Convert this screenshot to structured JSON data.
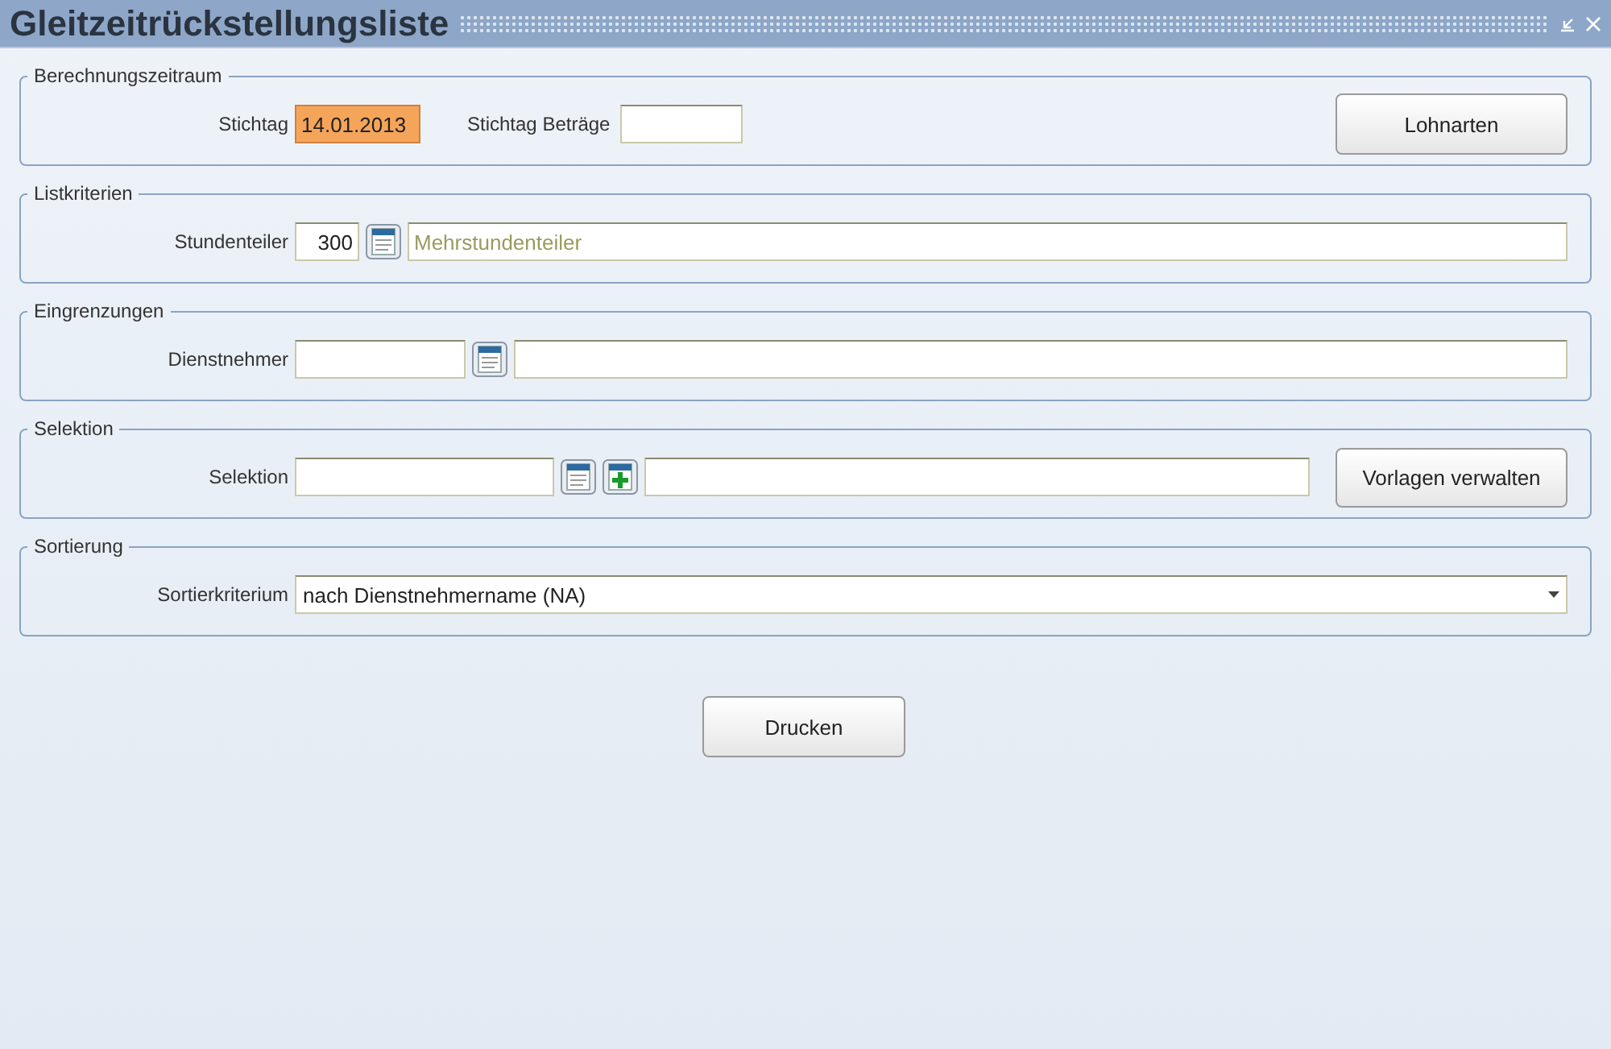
{
  "window": {
    "title": "Gleitzeitrückstellungsliste"
  },
  "berechnungszeitraum": {
    "legend": "Berechnungszeitraum",
    "stichtag": {
      "label": "Stichtag",
      "value": "14.01.2013",
      "focused": true
    },
    "stichtag_betraege": {
      "label": "Stichtag Beträge"
    },
    "button": "Lohnarten"
  },
  "listkriterien": {
    "legend": "Listkriterien",
    "label": "Stundenteiler",
    "value": "300",
    "description": "Mehrstundenteiler"
  },
  "eingrenzungen": {
    "legend": "Eingrenzungen",
    "label": "Dienstnehmer"
  },
  "selektion": {
    "legend": "Selektion",
    "label": "Selektion",
    "button": "Vorlagen verwalten"
  },
  "sortierung": {
    "legend": "Sortierung",
    "label": "Sortierkriterium",
    "value": "nach Dienstnehmername (NA)"
  },
  "print_button": "Drucken"
}
